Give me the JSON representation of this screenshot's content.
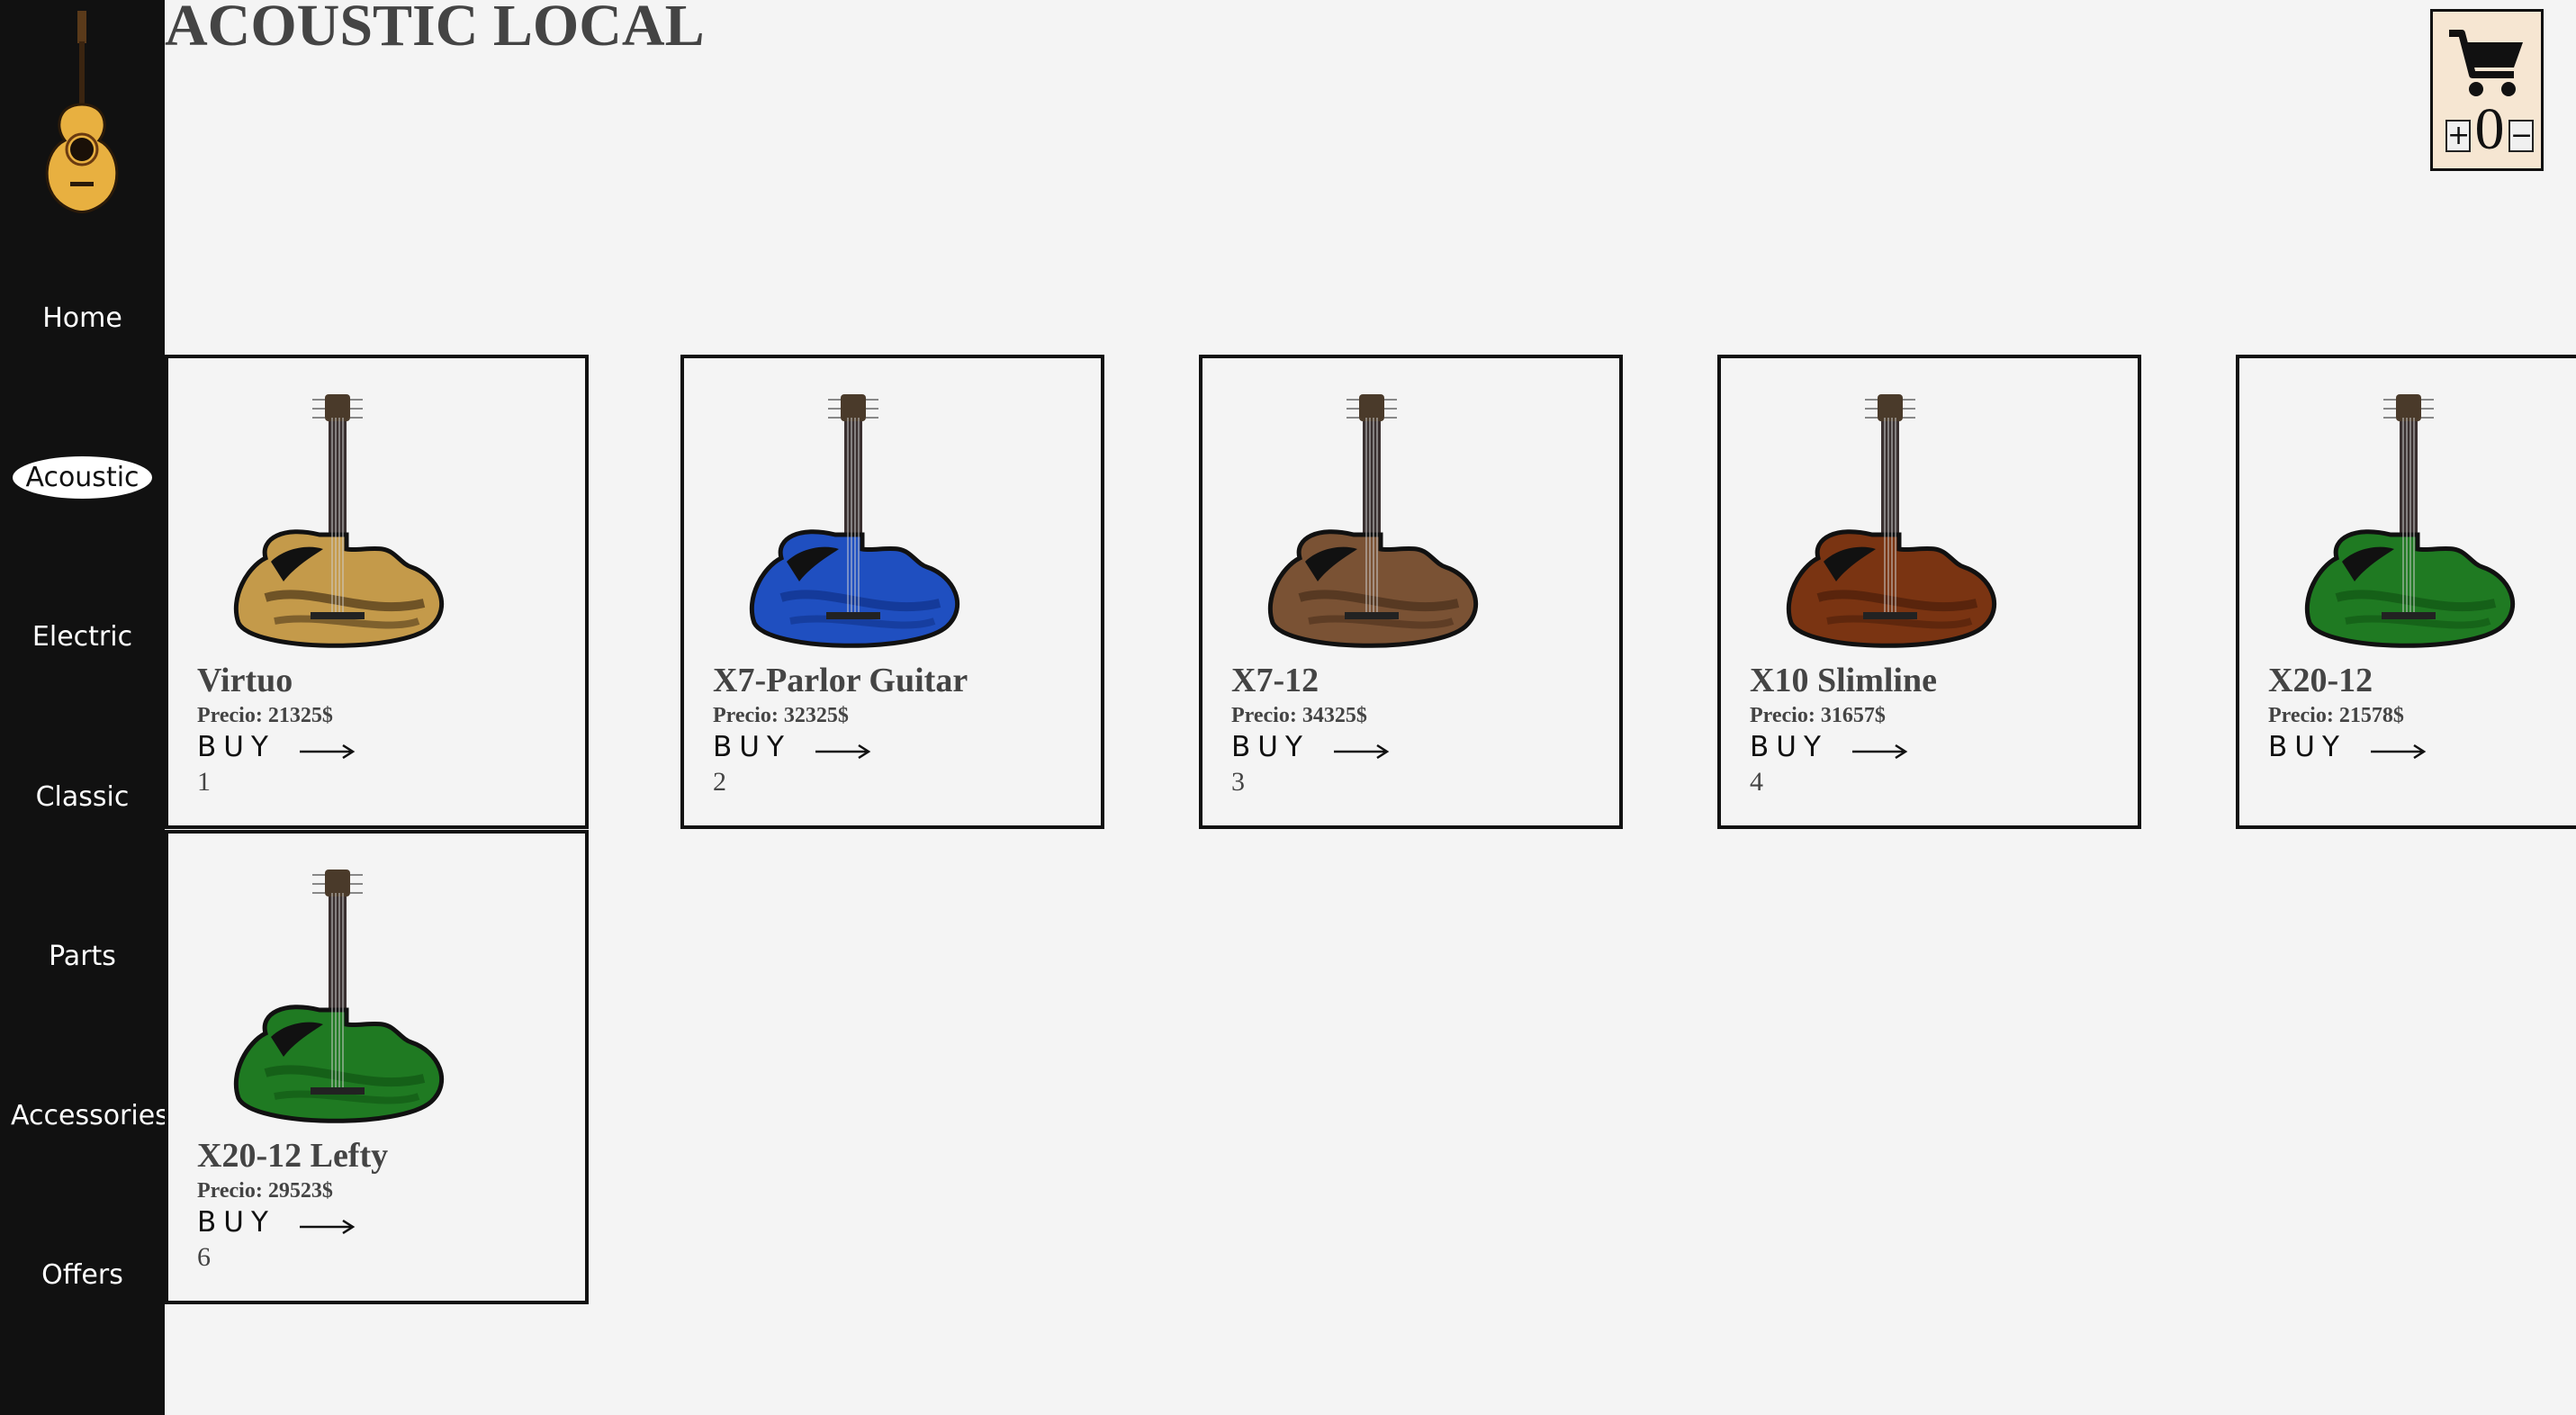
{
  "site": {
    "title": "ACOUSTIC LOCAL"
  },
  "cart": {
    "count": "0",
    "plus_label": "+",
    "minus_label": "−",
    "icon": "shopping-cart-icon"
  },
  "nav": {
    "items": [
      {
        "label": "Home",
        "active": false
      },
      {
        "label": "Acoustic",
        "active": true
      },
      {
        "label": "Electric",
        "active": false
      },
      {
        "label": "Classic",
        "active": false
      },
      {
        "label": "Parts",
        "active": false
      },
      {
        "label": "Accessories",
        "active": false
      },
      {
        "label": "Offers",
        "active": false
      }
    ]
  },
  "products": [
    {
      "name": "Virtuo",
      "price": "Precio: 21325$",
      "buy": "BUY",
      "id": "1",
      "body_color": "#c49a4a",
      "pattern_color": "#2a1a0a"
    },
    {
      "name": "X7-Parlor Guitar",
      "price": "Precio: 32325$",
      "buy": "BUY",
      "id": "2",
      "body_color": "#1f4fc0",
      "pattern_color": "#0b2a7a"
    },
    {
      "name": "X7-12",
      "price": "Precio: 34325$",
      "buy": "BUY",
      "id": "3",
      "body_color": "#7a5234",
      "pattern_color": "#3b2414"
    },
    {
      "name": "X10 Slimline",
      "price": "Precio: 31657$",
      "buy": "BUY",
      "id": "4",
      "body_color": "#7a3412",
      "pattern_color": "#3e1808"
    },
    {
      "name": "X20-12",
      "price": "Precio: 21578$",
      "buy": "BUY",
      "id": "",
      "body_color": "#1f7a22",
      "pattern_color": "#0c4a10"
    },
    {
      "name": "X20-12 Lefty",
      "price": "Precio: 29523$",
      "buy": "BUY",
      "id": "6",
      "body_color": "#1f7a22",
      "pattern_color": "#0c4a10"
    }
  ]
}
